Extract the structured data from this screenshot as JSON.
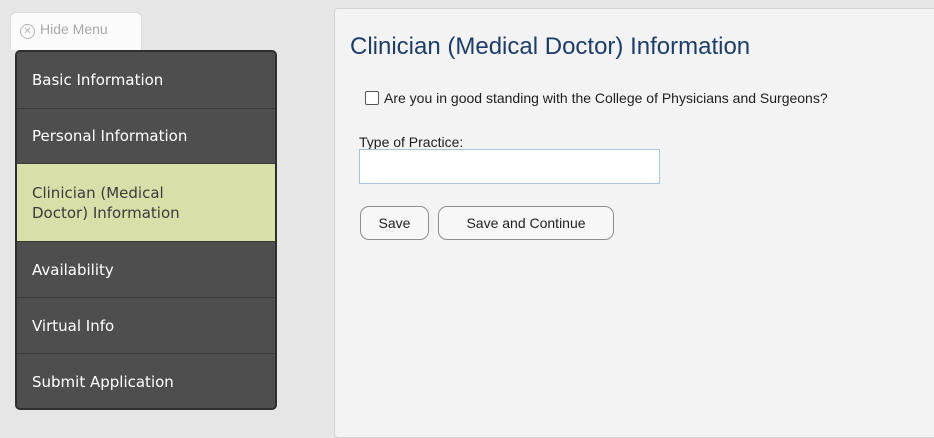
{
  "hide_menu": {
    "label": "Hide Menu",
    "icon": "close-circle-icon"
  },
  "sidebar": {
    "items": [
      {
        "label": "Basic Information",
        "active": false
      },
      {
        "label": "Personal Information",
        "active": false
      },
      {
        "label": "Clinician (Medical Doctor) Information",
        "active": true
      },
      {
        "label": "Availability",
        "active": false
      },
      {
        "label": "Virtual Info",
        "active": false
      },
      {
        "label": "Submit Application",
        "active": false
      }
    ]
  },
  "main": {
    "title": "Clinician (Medical Doctor) Information",
    "question": {
      "label": "Are you in good standing with the College of Physicians and Surgeons?",
      "checked": false
    },
    "type_of_practice": {
      "label": "Type of Practice:",
      "value": ""
    },
    "buttons": {
      "save": "Save",
      "save_continue": "Save and Continue"
    }
  },
  "colors": {
    "background": "#e6e6e6",
    "sidebar": "#4e4e4e",
    "sidebar_active": "#d9dfa9",
    "title": "#1c3d6b",
    "input_border": "#aac3d9"
  }
}
